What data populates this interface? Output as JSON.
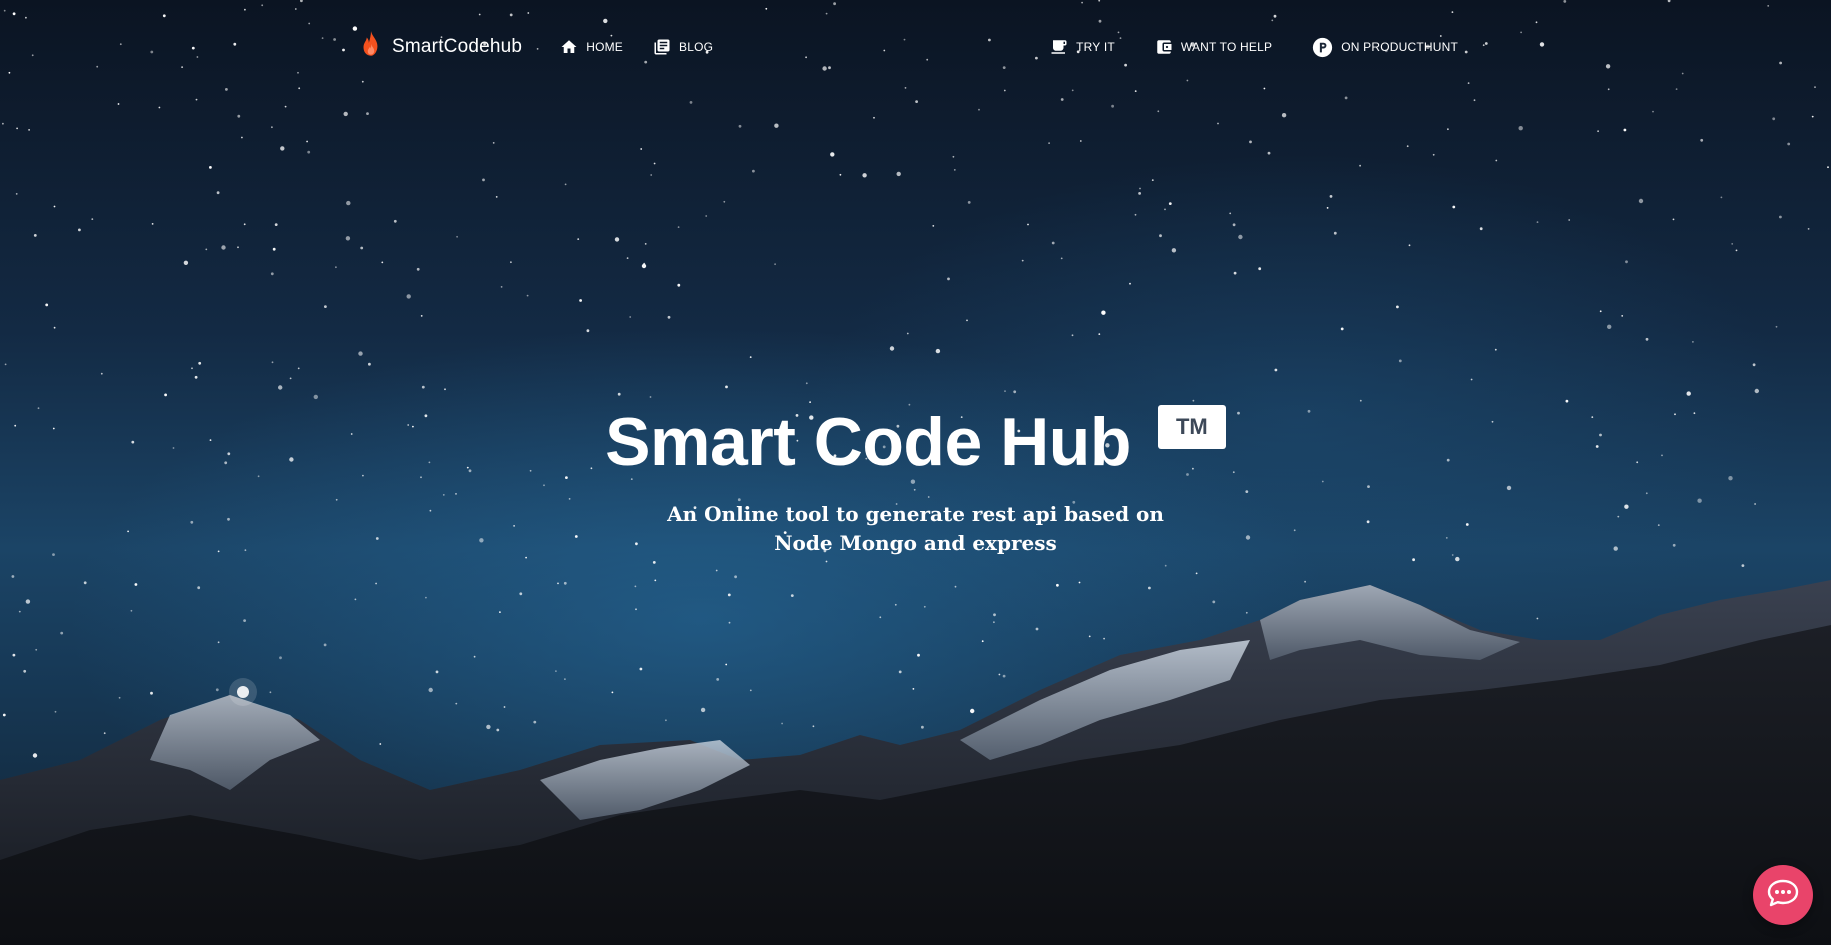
{
  "brand": {
    "name": "SmartCodehub",
    "icon": "fire-icon",
    "icon_color": "#f4511e"
  },
  "nav": {
    "left": [
      {
        "label": "HOME",
        "icon": "home-icon"
      },
      {
        "label": "BLOG",
        "icon": "library-books-icon"
      }
    ],
    "right": [
      {
        "label": "TRY IT",
        "icon": "coffee-icon"
      },
      {
        "label": "WANT TO HELP",
        "icon": "wallet-icon"
      },
      {
        "label": "ON PRODUCTHUNT",
        "icon": "producthunt-icon"
      }
    ]
  },
  "hero": {
    "title": "Smart Code Hub",
    "badge": "TM",
    "subtitle": "An Online tool to generate rest api based on Node Mongo and express"
  },
  "chat": {
    "icon": "chat-bubble-icon",
    "color": "#e9446a"
  },
  "colors": {
    "sky_top": "#0b1422",
    "sky_mid": "#1b4466",
    "text": "#ffffff",
    "badge_text": "#3c4858"
  }
}
